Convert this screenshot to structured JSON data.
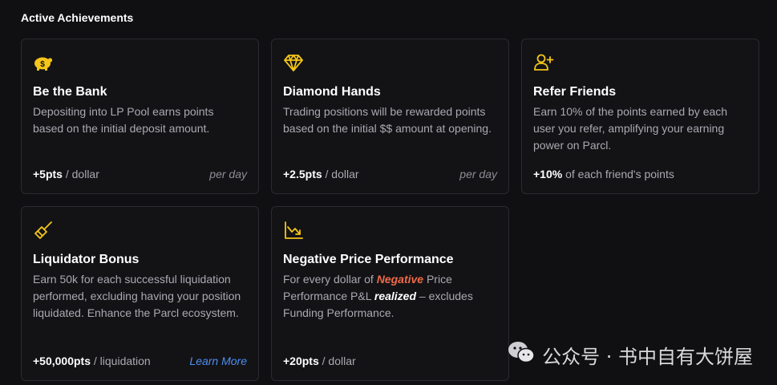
{
  "section": {
    "title": "Active Achievements"
  },
  "colors": {
    "accent": "#f5c518",
    "negative": "#ee6a4a",
    "link": "#4d8ff0"
  },
  "cards": [
    {
      "icon": "piggy-bank-icon",
      "title": "Be the Bank",
      "desc": "Depositing into LP Pool earns points based on the initial deposit amount.",
      "pts": "+5pts",
      "unit": " / dollar",
      "right": "per day"
    },
    {
      "icon": "diamond-icon",
      "title": "Diamond Hands",
      "desc": "Trading positions will be rewarded points based on the initial $$ amount at opening.",
      "pts": "+2.5pts",
      "unit": " / dollar",
      "right": "per day"
    },
    {
      "icon": "add-user-icon",
      "title": "Refer Friends",
      "desc": "Earn 10% of the points earned by each user you refer, amplifying your earning power on Parcl.",
      "pts": "+10%",
      "unit": " of each friend's points"
    },
    {
      "icon": "broom-icon",
      "title": "Liquidator Bonus",
      "desc": "Earn 50k for each successful liquidation performed, excluding having your position liquidated. Enhance the Parcl ecosystem.",
      "pts": "+50,000pts",
      "unit": " / liquidation",
      "link": "Learn More"
    },
    {
      "icon": "chart-down-icon",
      "title": "Negative Price Performance",
      "desc_parts": [
        "For every dollar of ",
        "Negative",
        " Price Performance P&L ",
        "realized",
        " – excludes Funding Performance."
      ],
      "pts": "+20pts",
      "unit": " / dollar"
    }
  ],
  "watermark": {
    "text": "公众号 · 书中自有大饼屋",
    "icon": "wechat-icon"
  }
}
